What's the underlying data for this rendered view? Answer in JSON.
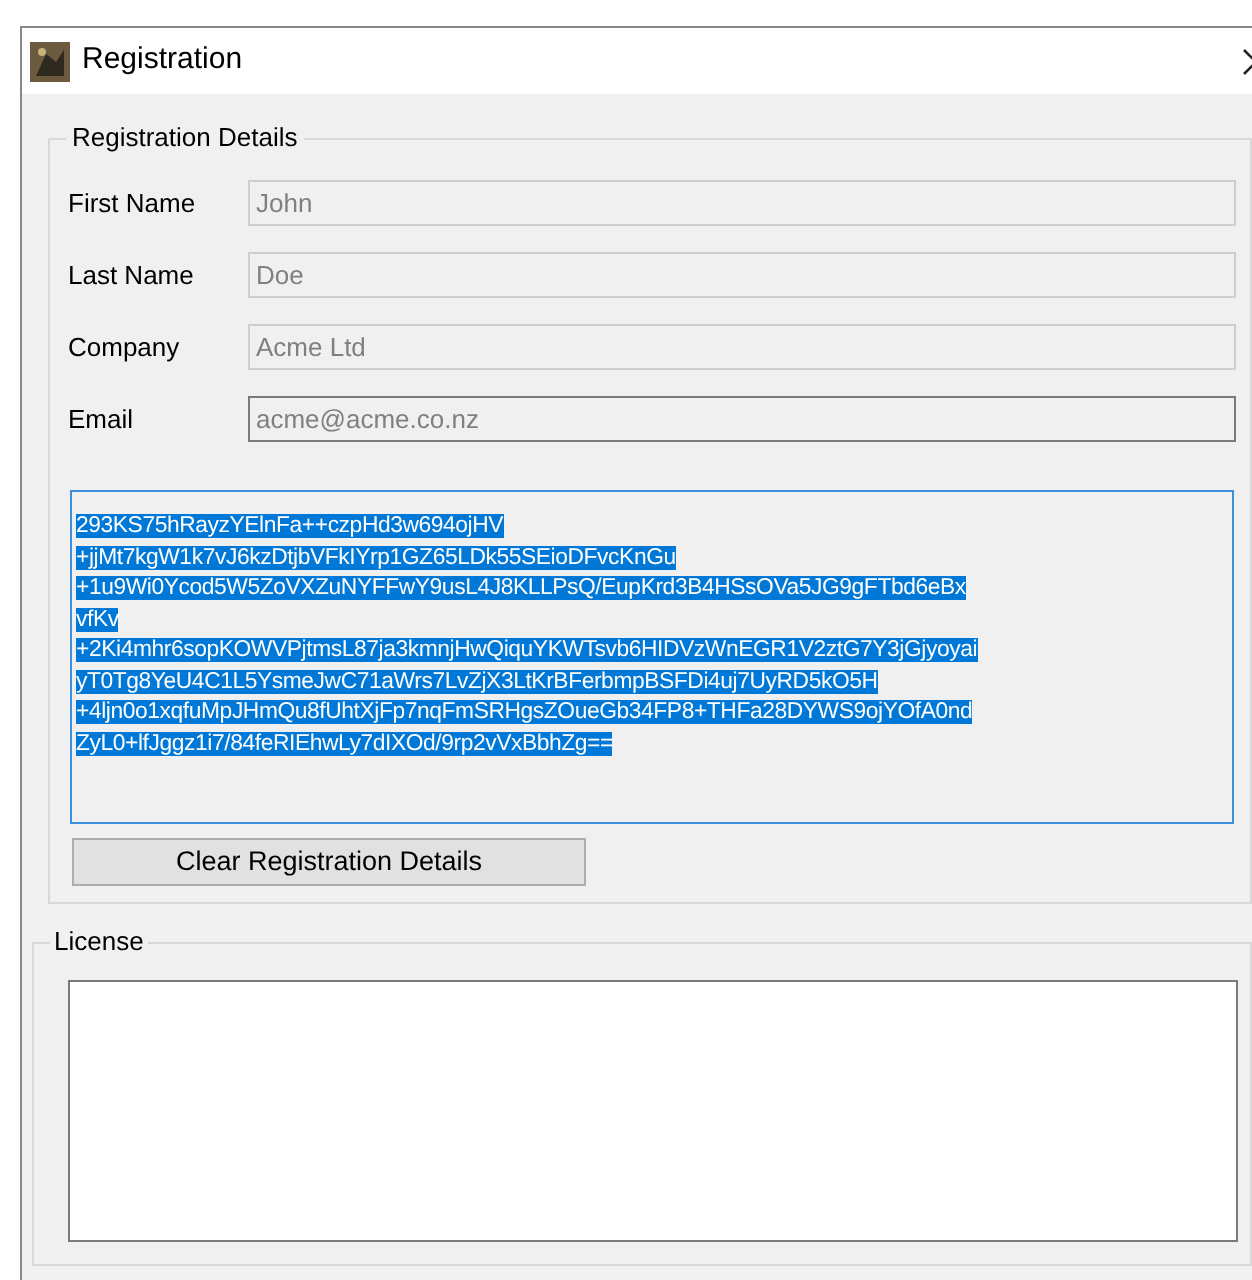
{
  "window": {
    "title": "Registration"
  },
  "registration_details": {
    "title": "Registration Details",
    "fields": [
      {
        "label": "First Name",
        "value": "John",
        "disabled": true,
        "focused": false
      },
      {
        "label": "Last Name",
        "value": "Doe",
        "disabled": true,
        "focused": false
      },
      {
        "label": "Company",
        "value": "Acme Ltd",
        "disabled": true,
        "focused": false
      },
      {
        "label": "Email",
        "value": "acme@acme.co.nz",
        "disabled": true,
        "focused": true
      }
    ],
    "key": {
      "selected": true,
      "lines": [
        "293KS75hRayzYElnFa++czpHd3w694ojHV",
        "+jjMt7kgW1k7vJ6kzDtjbVFkIYrp1GZ65LDk55SEioDFvcKnGu",
        "+1u9Wi0Ycod5W5ZoVXZuNYFFwY9usL4J8KLLPsQ/EupKrd3B4HSsOVa5JG9gFTbd6eBx",
        "vfKv",
        "+2Ki4mhr6sopKOWVPjtmsL87ja3kmnjHwQiquYKWTsvb6HIDVzWnEGR1V2ztG7Y3jGjyoyai",
        "yT0Tg8YeU4C1L5YsmeJwC71aWrs7LvZjX3LtKrBFerbmpBSFDi4uj7UyRD5kO5H",
        "+4ljn0o1xqfuMpJHmQu8fUhtXjFp7nqFmSRHgsZOueGb34FP8+THFa28DYWS9ojYOfA0nd",
        "ZyL0+lfJggz1i7/84feRIEhwLy7dIXOd/9rp2vVxBbhZg=="
      ]
    },
    "clear_button": "Clear Registration Details"
  },
  "license": {
    "title": "License"
  }
}
